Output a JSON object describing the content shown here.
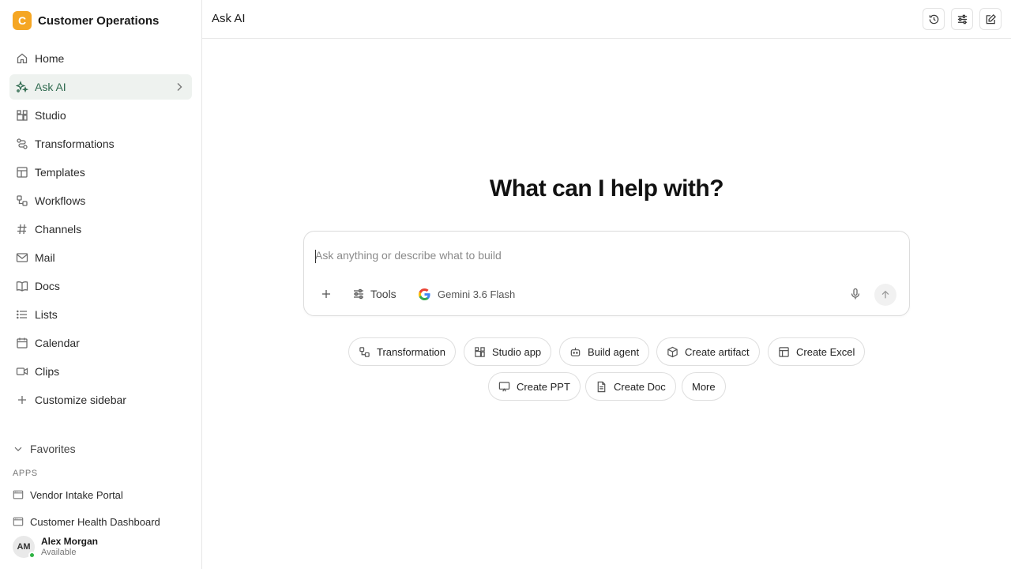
{
  "workspace": {
    "logo_letter": "C",
    "name": "Customer Operations"
  },
  "nav": [
    {
      "label": "Home",
      "icon": "home-icon"
    },
    {
      "label": "Ask AI",
      "icon": "sparkle-icon",
      "active": true
    },
    {
      "label": "Studio",
      "icon": "studio-icon"
    },
    {
      "label": "Transformations",
      "icon": "transform-icon"
    },
    {
      "label": "Templates",
      "icon": "template-icon"
    },
    {
      "label": "Workflows",
      "icon": "workflow-icon"
    },
    {
      "label": "Channels",
      "icon": "hash-icon"
    },
    {
      "label": "Mail",
      "icon": "mail-icon"
    },
    {
      "label": "Docs",
      "icon": "book-icon"
    },
    {
      "label": "Lists",
      "icon": "list-icon"
    },
    {
      "label": "Calendar",
      "icon": "calendar-icon"
    },
    {
      "label": "Clips",
      "icon": "video-icon"
    },
    {
      "label": "Customize sidebar",
      "icon": "plus-icon"
    }
  ],
  "favorites": {
    "label": "Favorites"
  },
  "apps": {
    "heading": "APPS",
    "items": [
      "Vendor Intake Portal",
      "Customer Health Dashboard"
    ]
  },
  "user": {
    "initials": "AM",
    "name": "Alex Morgan",
    "status": "Available",
    "status_color": "#2fb344"
  },
  "header": {
    "title": "Ask AI"
  },
  "main": {
    "headline": "What can I help with?",
    "composer": {
      "placeholder": "Ask anything or describe what to build",
      "tools_label": "Tools",
      "model_label": "Gemini 3.6 Flash"
    },
    "chips": [
      "Transformation",
      "Studio app",
      "Build agent",
      "Create artifact",
      "Create Excel",
      "Create PPT",
      "Create Doc",
      "More"
    ]
  },
  "colors": {
    "accent": "#2f6a4f",
    "active_bg": "#eef2ef",
    "workspace_logo": "#f5a623"
  }
}
